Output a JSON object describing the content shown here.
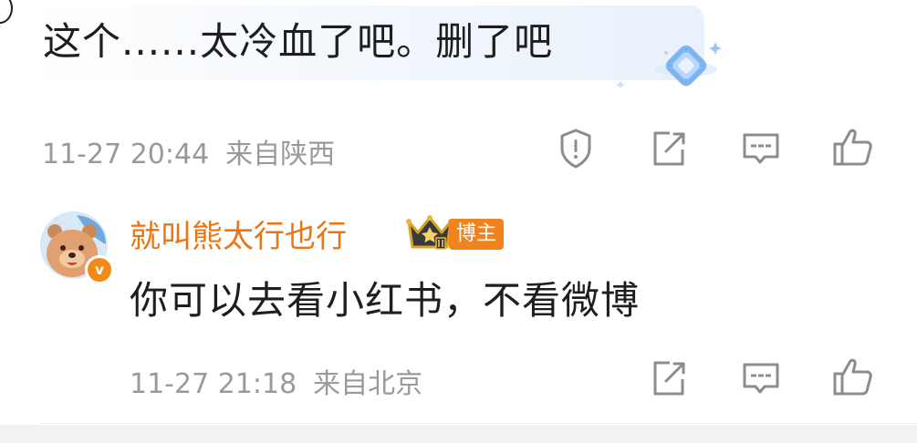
{
  "comment": {
    "text": "这个......太冷血了吧。删了吧",
    "time": "11-27 20:44",
    "location": "来自陕西"
  },
  "reply": {
    "username": "就叫熊太行也行",
    "badge": "博主",
    "text": "你可以去看小红书，不看微博",
    "time": "11-27 21:18",
    "location": "来自北京"
  },
  "icons": {
    "report": "warning-shield-icon",
    "share": "share-edit-icon",
    "comment": "comment-bubble-icon",
    "like": "thumbs-up-icon"
  },
  "colors": {
    "username": "#eb7413",
    "badge": "#f0831e",
    "meta": "#9a9a9a",
    "icon": "#8c8c8c"
  }
}
